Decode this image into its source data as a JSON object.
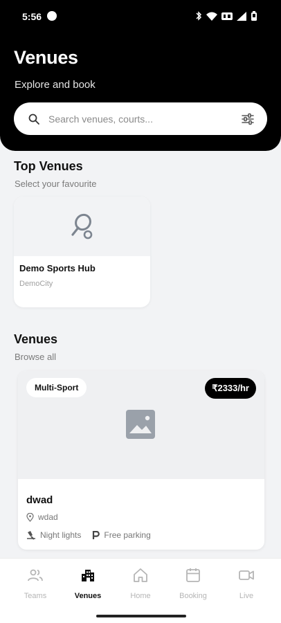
{
  "status_bar": {
    "time": "5:56"
  },
  "header": {
    "title": "Venues",
    "subtitle": "Explore and book",
    "search": {
      "placeholder": "Search venues, courts...",
      "value": ""
    }
  },
  "top_venues": {
    "title": "Top Venues",
    "subtitle": "Select your favourite",
    "cards": [
      {
        "name": "Demo Sports Hub",
        "city": "DemoCity",
        "icon": "racket-icon"
      }
    ]
  },
  "venues": {
    "title": "Venues",
    "subtitle": "Browse all",
    "items": [
      {
        "sport_badge": "Multi-Sport",
        "price_badge": "₹2333/hr",
        "name": "dwad",
        "location": "wdad",
        "amenities": [
          "Night lights",
          "Free parking"
        ]
      }
    ]
  },
  "bottom_nav": {
    "items": [
      {
        "label": "Teams",
        "icon": "teams-icon"
      },
      {
        "label": "Venues",
        "icon": "venues-icon",
        "active": true
      },
      {
        "label": "Home",
        "icon": "home-icon"
      },
      {
        "label": "Booking",
        "icon": "calendar-icon"
      },
      {
        "label": "Live",
        "icon": "video-icon"
      }
    ]
  },
  "colors": {
    "header_bg": "#000000",
    "page_bg": "#f2f3f5",
    "muted_text": "#7a7a7a",
    "inactive_nav": "#b5b5b5"
  }
}
